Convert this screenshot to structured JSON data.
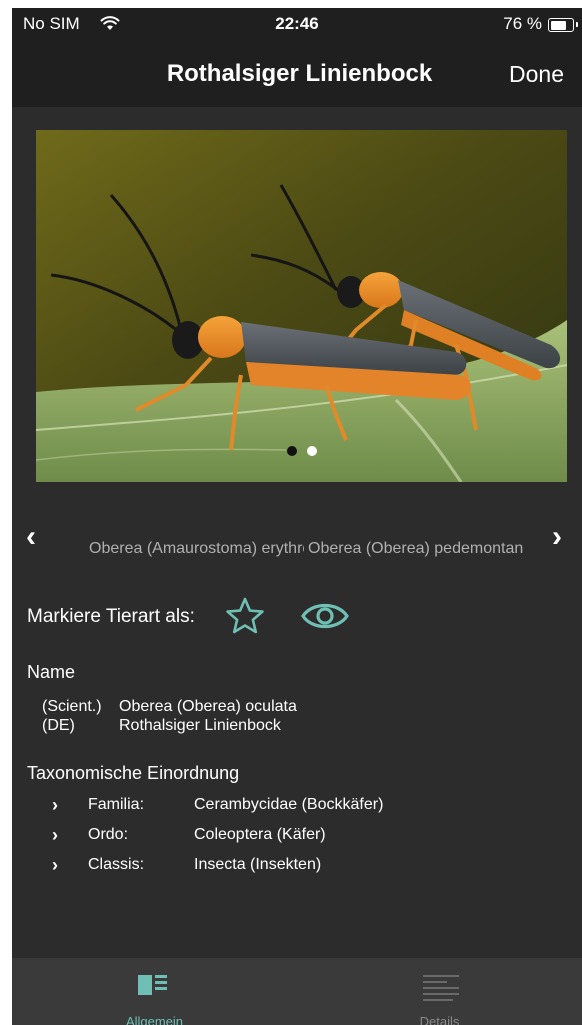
{
  "status_bar": {
    "carrier": "No SIM",
    "time": "22:46",
    "battery_text": "76 %",
    "battery_level": 0.76
  },
  "nav": {
    "title": "Rothalsiger Linienbock",
    "done_label": "Done"
  },
  "photo": {
    "page_count": 2,
    "active_page": 1
  },
  "carousel": {
    "prev_chevron": "‹",
    "next_chevron": "›",
    "left_item": "Oberea (Amaurostoma) erythrocephala",
    "right_item": "Oberea (Oberea) pedemontana"
  },
  "mark": {
    "label": "Markiere Tierart als:",
    "star_icon": "star-icon",
    "eye_icon": "eye-icon",
    "accent_color": "#6fbfb4"
  },
  "name_section": {
    "title": "Name",
    "rows": [
      {
        "key": "(Scient.)",
        "value": "Oberea (Oberea) oculata"
      },
      {
        "key": "(DE)",
        "value": "Rothalsiger Linienbock"
      }
    ]
  },
  "taxonomy": {
    "title": "Taxonomische Einordnung",
    "chevron": "›",
    "rows": [
      {
        "key": "Familia:",
        "value": "Cerambycidae (Bockkäfer)"
      },
      {
        "key": "Ordo:",
        "value": "Coleoptera (Käfer)"
      },
      {
        "key": "Classis:",
        "value": "Insecta (Insekten)"
      }
    ]
  },
  "tabs": [
    {
      "label": "Allgemein",
      "active": true,
      "icon": "general-info-icon"
    },
    {
      "label": "Details",
      "active": false,
      "icon": "details-list-icon"
    }
  ]
}
